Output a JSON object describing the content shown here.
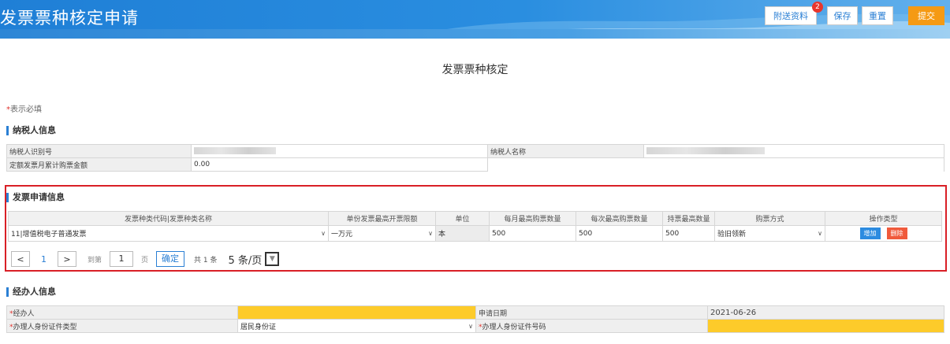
{
  "header": {
    "title": "发票票种核定申请",
    "attach_label": "附送资料",
    "attach_badge": "2",
    "save_label": "保存",
    "reset_label": "重置",
    "submit_label": "提交"
  },
  "form_title": "发票票种核定",
  "required_note": {
    "star": "*",
    "text": "表示必填"
  },
  "taxpayer": {
    "section_title": "纳税人信息",
    "id_label": "纳税人识别号",
    "name_label": "纳税人名称",
    "monthly_amount_label": "定额发票月累计购票金额",
    "monthly_amount_value": "0.00"
  },
  "invoice": {
    "section_title": "发票申请信息",
    "columns": [
      "发票种类代码|发票种类名称",
      "单份发票最高开票限额",
      "单位",
      "每月最高购票数量",
      "每次最高购票数量",
      "持票最高数量",
      "购票方式",
      "操作类型"
    ],
    "row": {
      "type": "11|增值税电子普通发票",
      "limit": "一万元",
      "unit": "本",
      "monthly_max": "500",
      "each_max": "500",
      "hold_max": "500",
      "method": "验旧领新",
      "add_label": "增加",
      "delete_label": "删除"
    },
    "pager": {
      "current_page": "1",
      "goto_label": "到第",
      "goto_value": "1",
      "page_unit": "页",
      "confirm_label": "确定",
      "total": "共 1 条",
      "page_size": "5 条/页"
    }
  },
  "agent": {
    "section_title": "经办人信息",
    "agent_label": "经办人",
    "date_label": "申请日期",
    "date_value": "2021-06-26",
    "id_type_label": "办理人身份证件类型",
    "id_type_value": "居民身份证",
    "id_no_label": "办理人身份证件号码"
  },
  "colors": {
    "brand": "#2a7fd4",
    "submit": "#f59a14",
    "highlight": "#fdcb2a",
    "error_border": "#d91f26"
  }
}
